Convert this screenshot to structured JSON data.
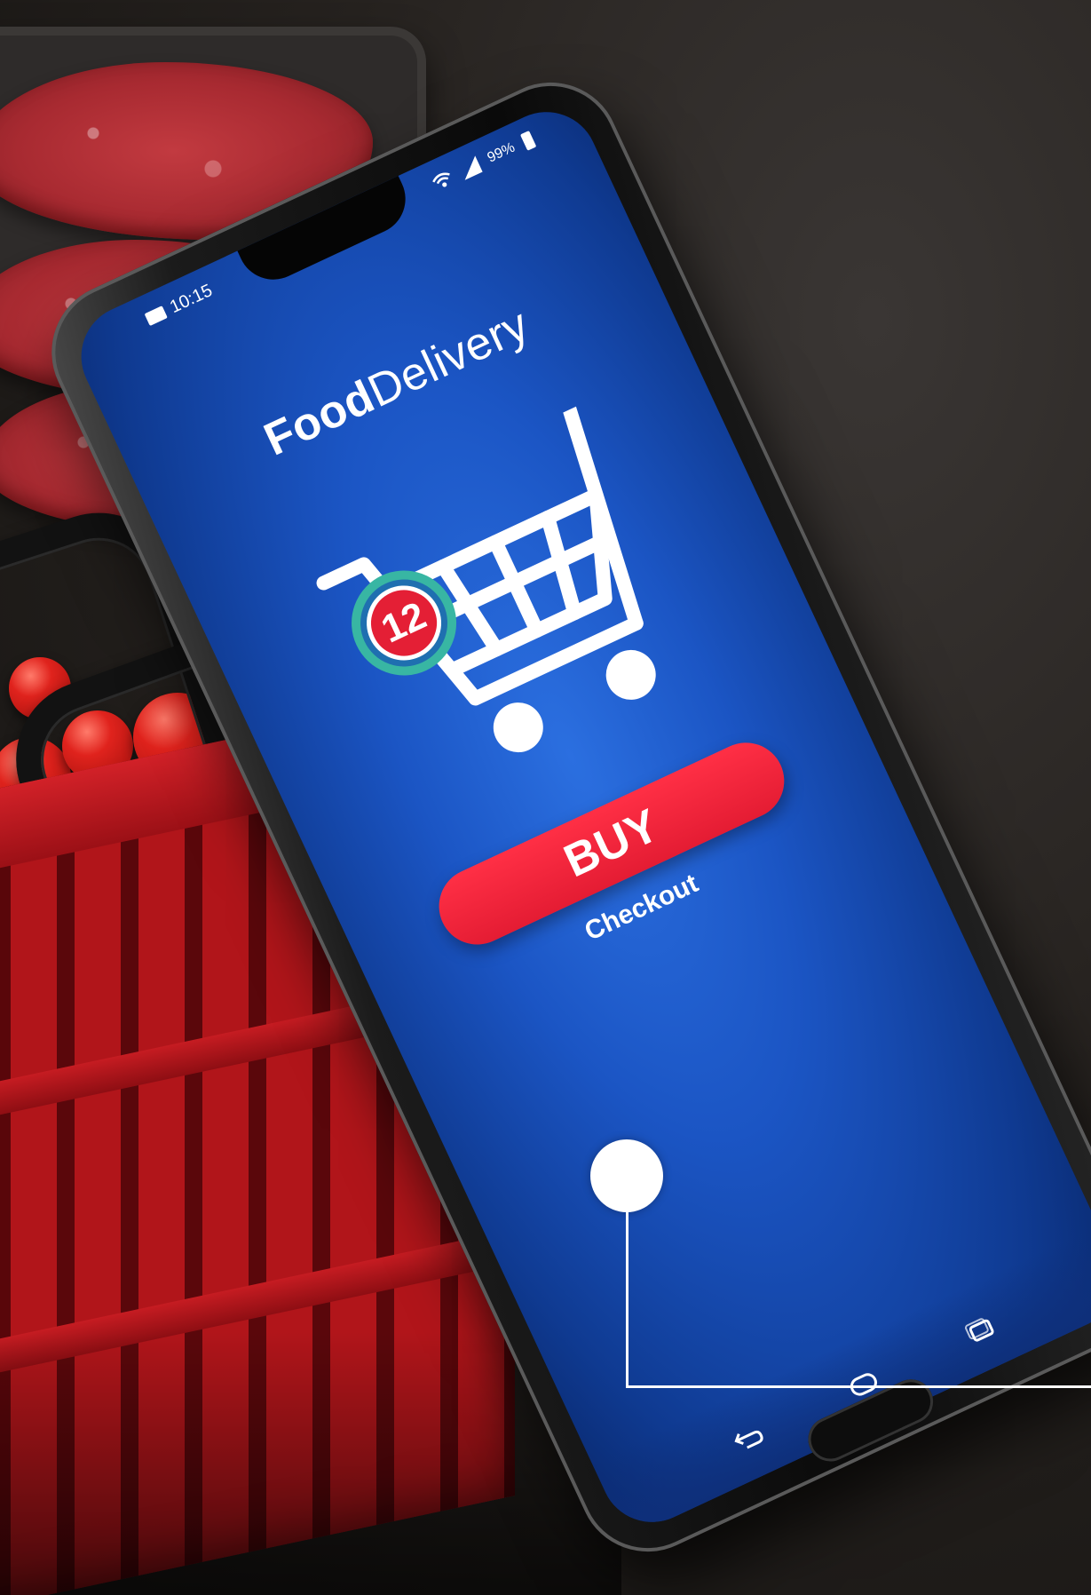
{
  "phone": {
    "status_bar": {
      "time": "10:15",
      "battery": "99%"
    },
    "app": {
      "title_bold": "Food",
      "title_light": "Delivery",
      "cart_badge_count": "12",
      "buy_label": "BUY",
      "checkout_label": "Checkout"
    },
    "colors": {
      "screen_blue": "#1b55c4",
      "buy_red": "#e41c33",
      "badge_red": "#e41f35",
      "badge_ring_teal": "#38b6a3"
    },
    "icons": [
      "message-icon",
      "wifi-icon",
      "signal-icon",
      "battery-icon",
      "shopping-cart-icon",
      "back-icon",
      "home-icon",
      "recent-apps-icon"
    ]
  }
}
